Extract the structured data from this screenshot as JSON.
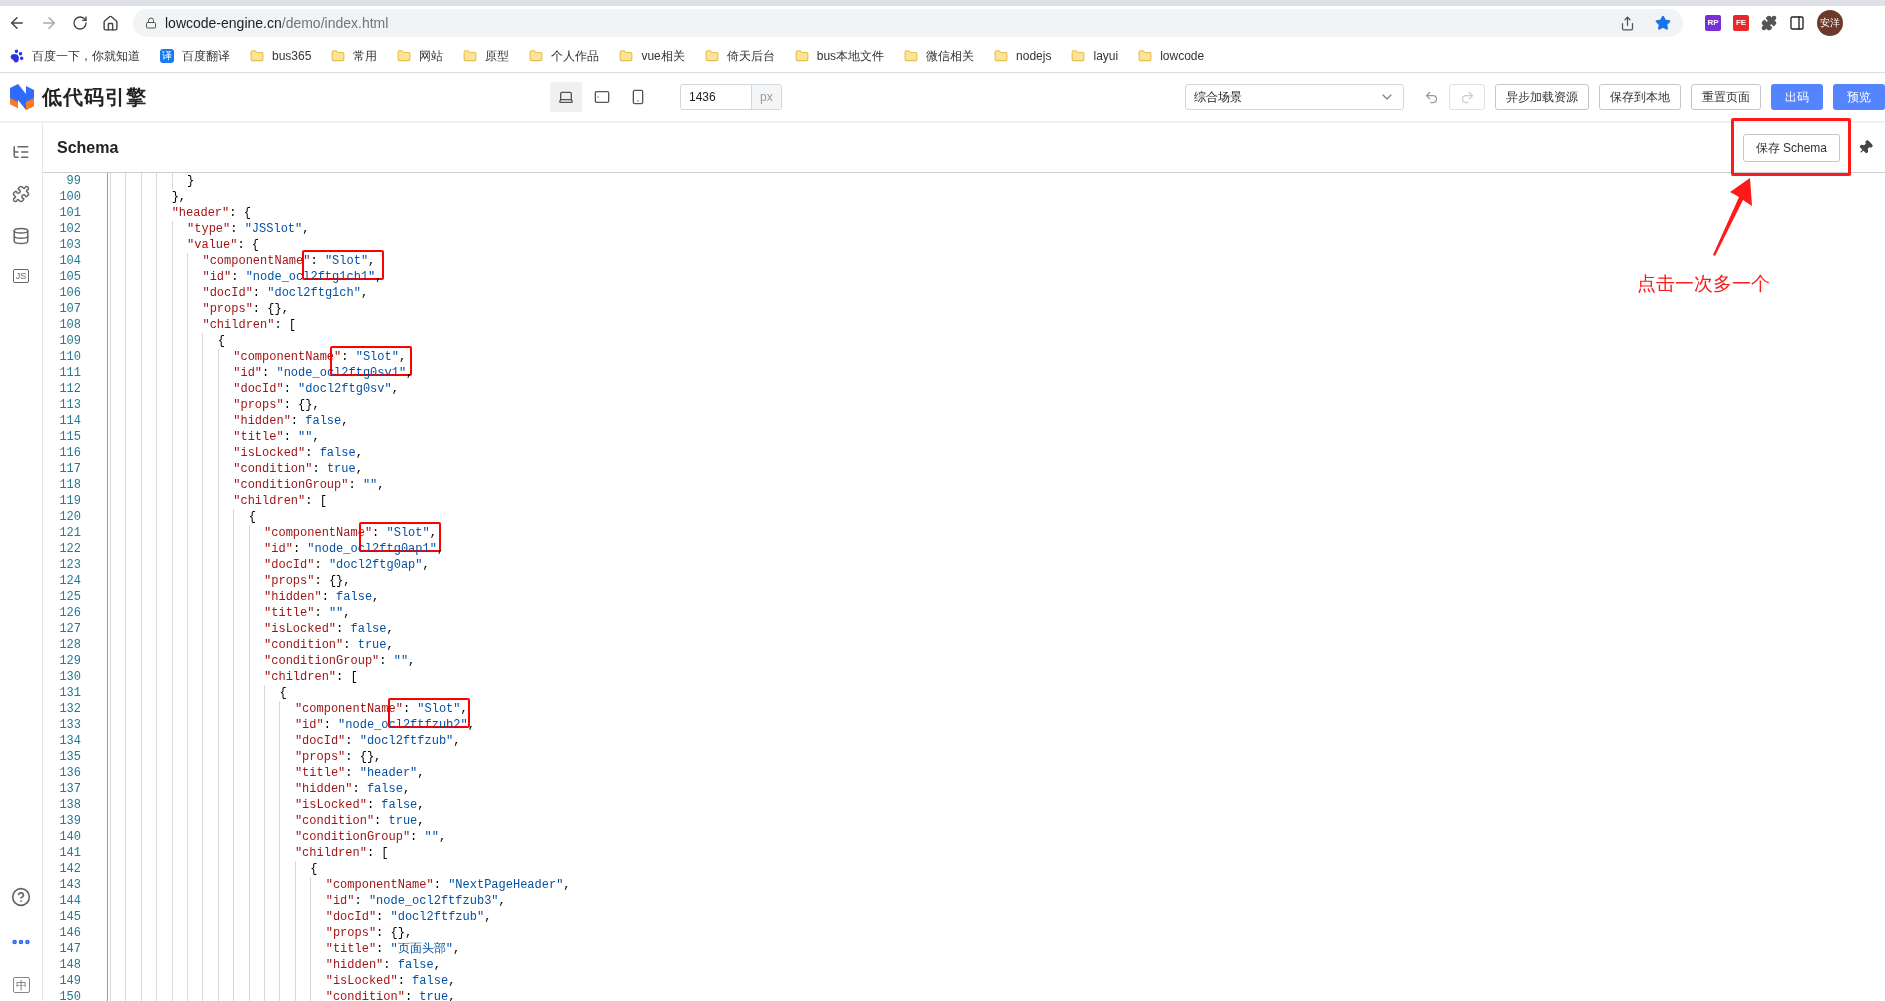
{
  "browser": {
    "url_host": "lowcode-engine.cn",
    "url_path": "/demo/index.html",
    "profile": "安洋",
    "extensions": [
      {
        "label": "RP",
        "color": "#7b2fd6"
      },
      {
        "label": "FE",
        "color": "#e8262c"
      }
    ]
  },
  "bookmarks": [
    {
      "label": "百度一下，你就知道",
      "kind": "baidu"
    },
    {
      "label": "百度翻译",
      "kind": "translate",
      "icon_text": "译"
    },
    {
      "label": "bus365",
      "kind": "folder"
    },
    {
      "label": "常用",
      "kind": "folder"
    },
    {
      "label": "网站",
      "kind": "folder"
    },
    {
      "label": "原型",
      "kind": "folder"
    },
    {
      "label": "个人作品",
      "kind": "folder"
    },
    {
      "label": "vue相关",
      "kind": "folder"
    },
    {
      "label": "倚天后台",
      "kind": "folder"
    },
    {
      "label": "bus本地文件",
      "kind": "folder"
    },
    {
      "label": "微信相关",
      "kind": "folder"
    },
    {
      "label": "nodejs",
      "kind": "folder"
    },
    {
      "label": "layui",
      "kind": "folder"
    },
    {
      "label": "lowcode",
      "kind": "folder"
    }
  ],
  "app": {
    "logo": "低代码引擎",
    "devices": [
      {
        "kind": "desktop",
        "selected": true
      },
      {
        "kind": "tablet",
        "selected": false
      },
      {
        "kind": "phone",
        "selected": false
      }
    ],
    "width_field": {
      "value": "1436",
      "unit": "px"
    },
    "scenario": "综合场景",
    "buttons": [
      {
        "label": "异步加载资源",
        "primary": false
      },
      {
        "label": "保存到本地",
        "primary": false
      },
      {
        "label": "重置页面",
        "primary": false
      },
      {
        "label": "出码",
        "primary": true
      },
      {
        "label": "预览",
        "primary": true
      }
    ]
  },
  "sidebar": {
    "top": [
      {
        "kind": "outline"
      },
      {
        "kind": "components"
      },
      {
        "kind": "datasource"
      },
      {
        "kind": "js",
        "label": "JS"
      }
    ],
    "bottom": [
      {
        "kind": "help"
      },
      {
        "kind": "more"
      },
      {
        "kind": "lang",
        "label": "中"
      }
    ]
  },
  "panel": {
    "title": "Schema",
    "save_button": "保存 Schema",
    "save_marked": true
  },
  "code": {
    "lines": [
      {
        "number": "99",
        "text": "          }",
        "marked": false
      },
      {
        "number": "100",
        "text": "        },",
        "marked": false
      },
      {
        "number": "101",
        "text": "        \"header\": {",
        "marked": false
      },
      {
        "number": "102",
        "text": "          \"type\": \"JSSlot\",",
        "marked": false
      },
      {
        "number": "103",
        "text": "          \"value\": {",
        "marked": false
      },
      {
        "number": "104",
        "text": "            \"componentName\": \"Slot\",",
        "marked": true
      },
      {
        "number": "105",
        "text": "            \"id\": \"node_ocl2ftg1ch1\",",
        "marked": false
      },
      {
        "number": "106",
        "text": "            \"docId\": \"docl2ftg1ch\",",
        "marked": false
      },
      {
        "number": "107",
        "text": "            \"props\": {},",
        "marked": false
      },
      {
        "number": "108",
        "text": "            \"children\": [",
        "marked": false
      },
      {
        "number": "109",
        "text": "              {",
        "marked": false
      },
      {
        "number": "110",
        "text": "                \"componentName\": \"Slot\",",
        "marked": true
      },
      {
        "number": "111",
        "text": "                \"id\": \"node_ocl2ftg0sv1\",",
        "marked": false
      },
      {
        "number": "112",
        "text": "                \"docId\": \"docl2ftg0sv\",",
        "marked": false
      },
      {
        "number": "113",
        "text": "                \"props\": {},",
        "marked": false
      },
      {
        "number": "114",
        "text": "                \"hidden\": false,",
        "marked": false
      },
      {
        "number": "115",
        "text": "                \"title\": \"\",",
        "marked": false
      },
      {
        "number": "116",
        "text": "                \"isLocked\": false,",
        "marked": false
      },
      {
        "number": "117",
        "text": "                \"condition\": true,",
        "marked": false
      },
      {
        "number": "118",
        "text": "                \"conditionGroup\": \"\",",
        "marked": false
      },
      {
        "number": "119",
        "text": "                \"children\": [",
        "marked": false
      },
      {
        "number": "120",
        "text": "                  {",
        "marked": false
      },
      {
        "number": "121",
        "text": "                    \"componentName\": \"Slot\",",
        "marked": true
      },
      {
        "number": "122",
        "text": "                    \"id\": \"node_ocl2ftg0ap1\",",
        "marked": false
      },
      {
        "number": "123",
        "text": "                    \"docId\": \"docl2ftg0ap\",",
        "marked": false
      },
      {
        "number": "124",
        "text": "                    \"props\": {},",
        "marked": false
      },
      {
        "number": "125",
        "text": "                    \"hidden\": false,",
        "marked": false
      },
      {
        "number": "126",
        "text": "                    \"title\": \"\",",
        "marked": false
      },
      {
        "number": "127",
        "text": "                    \"isLocked\": false,",
        "marked": false
      },
      {
        "number": "128",
        "text": "                    \"condition\": true,",
        "marked": false
      },
      {
        "number": "129",
        "text": "                    \"conditionGroup\": \"\",",
        "marked": false
      },
      {
        "number": "130",
        "text": "                    \"children\": [",
        "marked": false
      },
      {
        "number": "131",
        "text": "                      {",
        "marked": false
      },
      {
        "number": "132",
        "text": "                        \"componentName\": \"Slot\",",
        "marked": true
      },
      {
        "number": "133",
        "text": "                        \"id\": \"node_ocl2ftfzub2\",",
        "marked": false
      },
      {
        "number": "134",
        "text": "                        \"docId\": \"docl2ftfzub\",",
        "marked": false
      },
      {
        "number": "135",
        "text": "                        \"props\": {},",
        "marked": false
      },
      {
        "number": "136",
        "text": "                        \"title\": \"header\",",
        "marked": false
      },
      {
        "number": "137",
        "text": "                        \"hidden\": false,",
        "marked": false
      },
      {
        "number": "138",
        "text": "                        \"isLocked\": false,",
        "marked": false
      },
      {
        "number": "139",
        "text": "                        \"condition\": true,",
        "marked": false
      },
      {
        "number": "140",
        "text": "                        \"conditionGroup\": \"\",",
        "marked": false
      },
      {
        "number": "141",
        "text": "                        \"children\": [",
        "marked": false
      },
      {
        "number": "142",
        "text": "                          {",
        "marked": false
      },
      {
        "number": "143",
        "text": "                            \"componentName\": \"NextPageHeader\",",
        "marked": false
      },
      {
        "number": "144",
        "text": "                            \"id\": \"node_ocl2ftfzub3\",",
        "marked": false
      },
      {
        "number": "145",
        "text": "                            \"docId\": \"docl2ftfzub\",",
        "marked": false
      },
      {
        "number": "146",
        "text": "                            \"props\": {},",
        "marked": false
      },
      {
        "number": "147",
        "text": "                            \"title\": \"页面头部\",",
        "marked": false
      },
      {
        "number": "148",
        "text": "                            \"hidden\": false,",
        "marked": false
      },
      {
        "number": "149",
        "text": "                            \"isLocked\": false,",
        "marked": false
      },
      {
        "number": "150",
        "text": "                            \"condition\": true,",
        "marked": false
      }
    ]
  },
  "annotation": {
    "text": "点击一次多一个"
  }
}
